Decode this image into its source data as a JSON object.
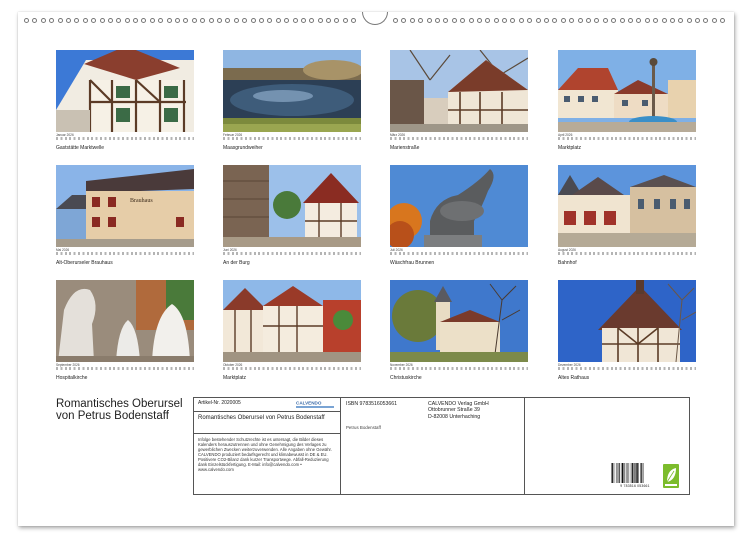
{
  "months": [
    {
      "month": "Januar 2026",
      "caption": "Gaststätte Marktwelle"
    },
    {
      "month": "Februar 2026",
      "caption": "Maasgrundweiher"
    },
    {
      "month": "März 2026",
      "caption": "Marienstraße"
    },
    {
      "month": "April 2026",
      "caption": "Marktplatz"
    },
    {
      "month": "Mai 2026",
      "caption": "Alt-Oberurseler Brauhaus"
    },
    {
      "month": "Juni 2026",
      "caption": "An der Burg"
    },
    {
      "month": "Juli 2026",
      "caption": "Wäschfrau Brunnen"
    },
    {
      "month": "August 2026",
      "caption": "Bahnhof"
    },
    {
      "month": "September 2026",
      "caption": "Hospitalkirche"
    },
    {
      "month": "Oktober 2026",
      "caption": "Marktplatz"
    },
    {
      "month": "November 2026",
      "caption": "Christuskirche"
    },
    {
      "month": "Dezember 2026",
      "caption": "Altes Rathaus"
    }
  ],
  "title": "Romantisches Oberursel von Petrus Bodenstaff",
  "info": {
    "article": "Artikel-Nr. 2020005",
    "publisher_logo": "CALVENDO",
    "calendar_title": "Romantisches Oberursel von Petrus Bodenstaff",
    "description": "Infolge bestehender Schutzrechte ist es untersagt, die Bilder dieses Kalenders herauszutrennen und ohne Genehmigung des Verlages zu gewerblichen Zwecken weiterzuverwenden. Alle Angaben ohne Gewähr. CALVENDO produziert bedarfsgerecht und klimabewusst in DE & EU. Positivere CO2-Bilanz dank kurzer Transportwege. Abfall-Reduzierung dank Einzelstückfertigung. E-Mail: info@calvendo.com • www.calvendo.com",
    "isbn": "ISBN 9783516053661",
    "author": "Petrus Bodenstaff",
    "publisher_address": [
      "CALVENDO Verlag GmbH",
      "Ottobrunner Straße 39",
      "D-82008 Unterhaching"
    ],
    "barcode_digits": "9 783516 053661"
  },
  "colors": {
    "sky": "#5a8fd8",
    "roof": "#b44a32",
    "timber": "#6b4a32",
    "eco_green": "#7cbc2c"
  }
}
